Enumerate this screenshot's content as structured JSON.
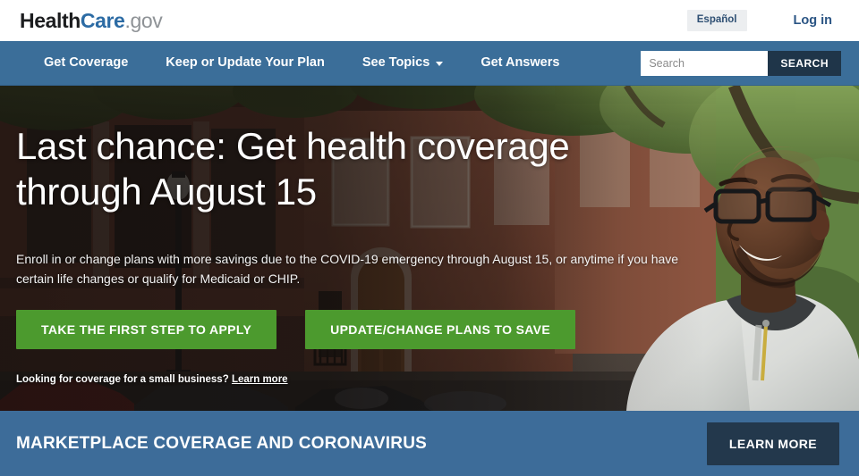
{
  "site": {
    "logo_health": "Health",
    "logo_care": "Care",
    "logo_gov": ".gov"
  },
  "topbar": {
    "espanol_label": "Español",
    "login_label": "Log in"
  },
  "nav": {
    "items": [
      {
        "label": "Get Coverage",
        "has_dropdown": false
      },
      {
        "label": "Keep or Update Your Plan",
        "has_dropdown": false
      },
      {
        "label": "See Topics",
        "has_dropdown": true
      },
      {
        "label": "Get Answers",
        "has_dropdown": false
      }
    ],
    "search": {
      "placeholder": "Search",
      "value": "",
      "button_label": "SEARCH"
    }
  },
  "hero": {
    "title": "Last chance: Get health coverage through August 15",
    "subtitle": "Enroll in or change plans with more savings due to the COVID-19 emergency through August 15, or anytime if you have certain life changes or qualify for Medicaid or CHIP.",
    "primary_cta": "TAKE THE FIRST STEP TO APPLY",
    "secondary_cta": "UPDATE/CHANGE PLANS TO SAVE",
    "smallbiz_text": "Looking for coverage for a small business?",
    "smallbiz_link": "Learn more"
  },
  "banner": {
    "title": "MARKETPLACE COVERAGE AND CORONAVIRUS",
    "button_label": "LEARN MORE"
  },
  "colors": {
    "nav_blue": "#3b6e99",
    "banner_blue": "#3d6c99",
    "cta_green": "#4c9a2e",
    "dark_navy": "#23384c",
    "logo_blue": "#2c6ba4",
    "login_blue": "#2b5584"
  }
}
